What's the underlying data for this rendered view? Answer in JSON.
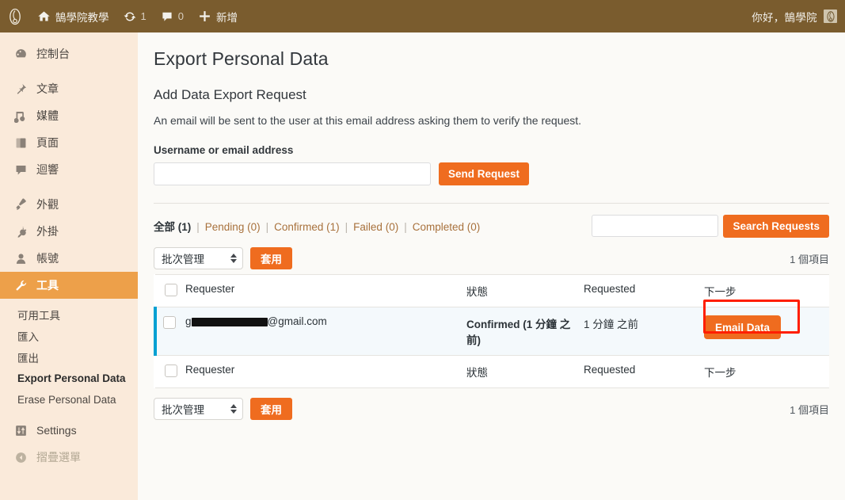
{
  "adminbar": {
    "site_logo_icon": "site-logo-icon",
    "home_icon": "home-icon",
    "site_name": "鵠學院教學",
    "updates_icon": "updates-icon",
    "updates_count": "1",
    "comments_icon": "comment-bubble-icon",
    "comments_count": "0",
    "new_icon": "plus-icon",
    "new_label": "新增",
    "howdy": "你好，鵠學院",
    "avatar_icon": "avatar-icon"
  },
  "sidebar": {
    "items": [
      {
        "label": "控制台",
        "icon": "dashboard-icon",
        "name": "dashboard"
      },
      {
        "label": "文章",
        "icon": "pin-icon",
        "name": "posts"
      },
      {
        "label": "媒體",
        "icon": "media-icon",
        "name": "media"
      },
      {
        "label": "頁面",
        "icon": "pages-icon",
        "name": "pages"
      },
      {
        "label": "迴響",
        "icon": "comments-icon",
        "name": "comments"
      },
      {
        "label": "外觀",
        "icon": "appearance-brush-icon",
        "name": "appearance"
      },
      {
        "label": "外掛",
        "icon": "plugin-plug-icon",
        "name": "plugins"
      },
      {
        "label": "帳號",
        "icon": "users-icon",
        "name": "users"
      },
      {
        "label": "工具",
        "icon": "tools-wrench-icon",
        "name": "tools"
      },
      {
        "label": "Settings",
        "icon": "settings-sliders-icon",
        "name": "settings"
      }
    ],
    "submenu": [
      {
        "label": "可用工具",
        "name": "available-tools"
      },
      {
        "label": "匯入",
        "name": "import"
      },
      {
        "label": "匯出",
        "name": "export"
      },
      {
        "label": "Export Personal Data",
        "name": "export-personal-data"
      },
      {
        "label": "Erase Personal Data",
        "name": "erase-personal-data"
      }
    ],
    "collapse": {
      "label": "摺疊選單",
      "icon": "collapse-arrow-icon"
    }
  },
  "main": {
    "page_title": "Export Personal Data",
    "section_title": "Add Data Export Request",
    "section_desc": "An email will be sent to the user at this email address asking them to verify the request.",
    "field_label": "Username or email address",
    "username_value": "",
    "username_placeholder": "",
    "send_request_label": "Send Request",
    "filters": [
      {
        "label": "全部",
        "count": "(1)",
        "current": true
      },
      {
        "label": "Pending",
        "count": "(0)",
        "current": false
      },
      {
        "label": "Confirmed",
        "count": "(1)",
        "current": false
      },
      {
        "label": "Failed",
        "count": "(0)",
        "current": false
      },
      {
        "label": "Completed",
        "count": "(0)",
        "current": false
      }
    ],
    "filter_divider": "|",
    "search_value": "",
    "search_placeholder": "",
    "search_button_label": "Search Requests",
    "bulk_label": "批次管理",
    "apply_label": "套用",
    "count_top": "1 個項目",
    "count_bottom": "1 個項目",
    "table": {
      "columns": [
        "Requester",
        "狀態",
        "Requested",
        "下一步"
      ],
      "rows": [
        {
          "email_prefix": "g",
          "email_suffix": "@gmail.com",
          "email_redacted": true,
          "status": "Confirmed (1 分鐘 之前)",
          "requested": "1 分鐘 之前",
          "next_step_label": "Email Data"
        }
      ]
    }
  },
  "annotation": {
    "name": "red-highlight-box",
    "color": "#ff1e00"
  }
}
